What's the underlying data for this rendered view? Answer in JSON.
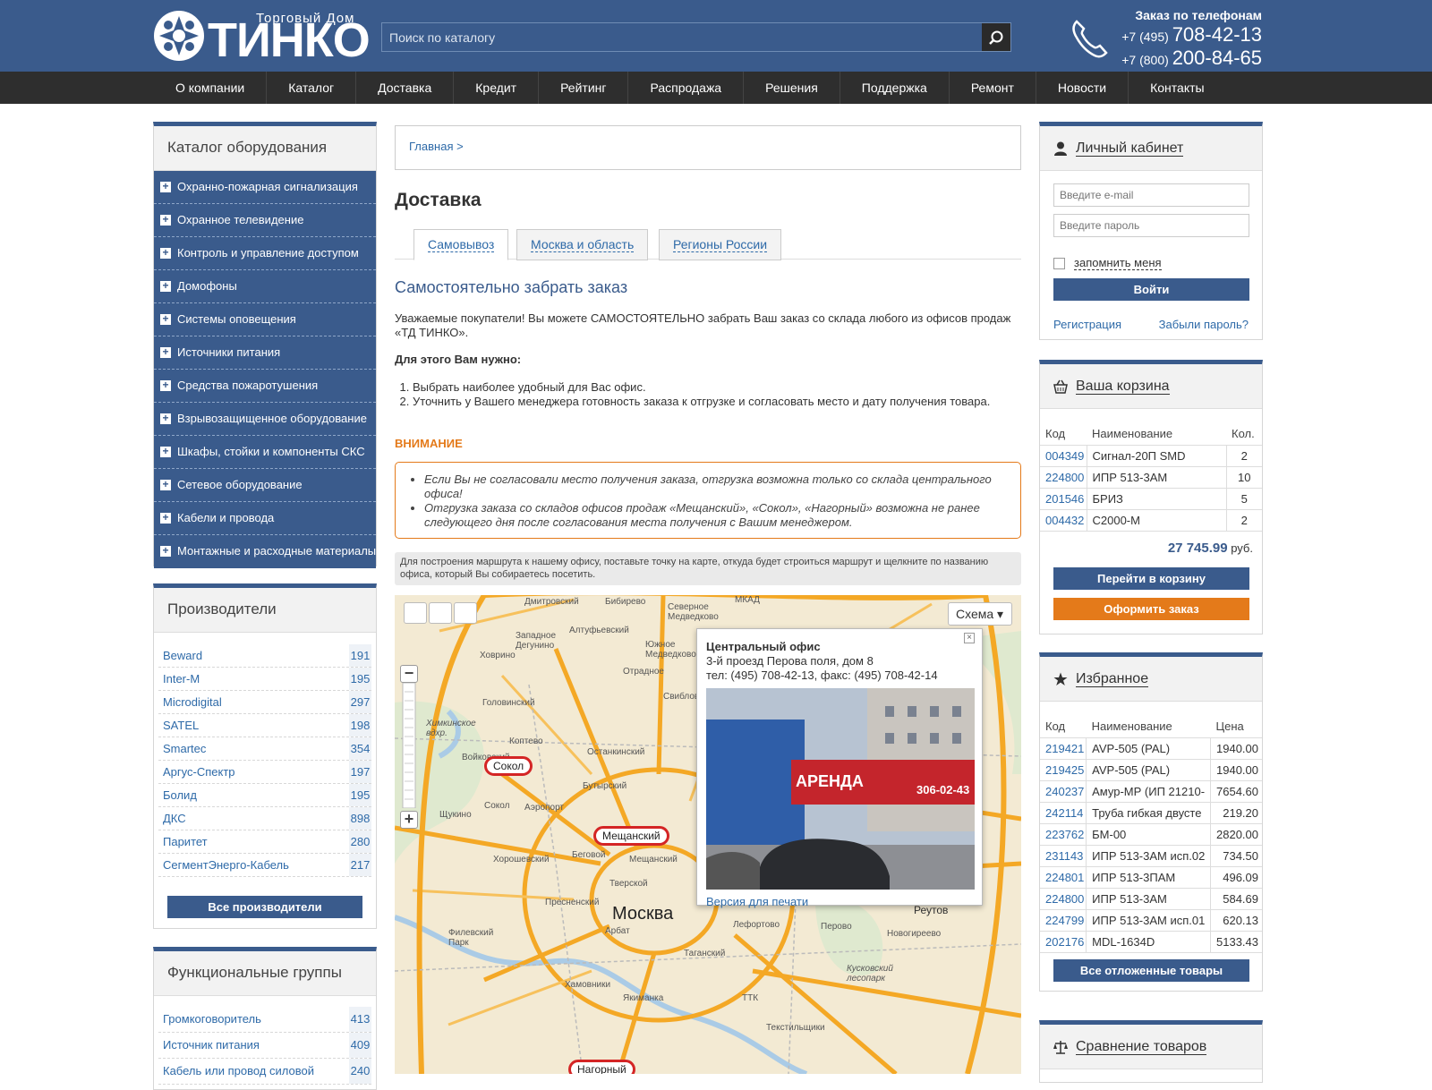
{
  "header": {
    "logo_sub": "Торговый Дом",
    "logo_text": "ТИНКО",
    "search_placeholder": "Поиск по каталогу",
    "phone_title": "Заказ по телефонам",
    "phone1_prefix": "+7 (495)",
    "phone1_number": "708-42-13",
    "phone2_prefix": "+7 (800)",
    "phone2_number": "200-84-65"
  },
  "nav": [
    "О компании",
    "Каталог",
    "Доставка",
    "Кредит",
    "Рейтинг",
    "Распродажа",
    "Решения",
    "Поддержка",
    "Ремонт",
    "Новости",
    "Контакты"
  ],
  "catalog": {
    "title": "Каталог оборудования",
    "items": [
      "Охранно-пожарная сигнализация",
      "Охранное телевидение",
      "Контроль и управление доступом",
      "Домофоны",
      "Системы оповещения",
      "Источники питания",
      "Средства пожаротушения",
      "Взрывозащищенное оборудование",
      "Шкафы, стойки и компоненты СКС",
      "Сетевое оборудование",
      "Кабели и провода",
      "Монтажные и расходные материалы"
    ]
  },
  "makers": {
    "title": "Производители",
    "items": [
      {
        "name": "Beward",
        "count": "191"
      },
      {
        "name": "Inter-M",
        "count": "195"
      },
      {
        "name": "Microdigital",
        "count": "297"
      },
      {
        "name": "SATEL",
        "count": "198"
      },
      {
        "name": "Smartec",
        "count": "354"
      },
      {
        "name": "Аргус-Спектр",
        "count": "197"
      },
      {
        "name": "Болид",
        "count": "195"
      },
      {
        "name": "ДКС",
        "count": "898"
      },
      {
        "name": "Паритет",
        "count": "280"
      },
      {
        "name": "СегментЭнерго-Кабель",
        "count": "217"
      }
    ],
    "all_label": "Все производители"
  },
  "groups": {
    "title": "Функциональные группы",
    "items": [
      {
        "name": "Громкоговоритель",
        "count": "413"
      },
      {
        "name": "Источник питания",
        "count": "409"
      },
      {
        "name": "Кабель или провод силовой",
        "count": "240"
      }
    ]
  },
  "content": {
    "breadcrumb": "Главная >",
    "title": "Доставка",
    "tabs": [
      "Самовывоз",
      "Москва и область",
      "Регионы России"
    ],
    "subtitle": "Самостоятельно забрать заказ",
    "intro": "Уважаемые покупатели! Вы можете САМОСТОЯТЕЛЬНО забрать Ваш заказ со склада любого из офисов продаж «ТД ТИНКО».",
    "need": "Для этого Вам нужно:",
    "steps": [
      "Выбрать наиболее удобный для Вас офис.",
      "Уточнить у Вашего менеджера готовность заказа к отгрузке и согласовать место и дату получения товара."
    ],
    "warn_title": "ВНИМАНИЕ",
    "warn_items": [
      "Если Вы не согласовали место получения заказа, отгрузка возможна только со склада центрального офиса!",
      "Отгрузка заказа со складов офисов продаж «Мещанский», «Сокол», «Нагорный» возможна не ранее следующего дня после согласования места получения с Вашим менеджером."
    ],
    "map_hint": "Для построения маршрута к нашему офису, поставьте точку на карте, откуда будет строиться маршрут и щелкните по названию офиса, который Вы собираетесь посетить."
  },
  "map": {
    "type_label": "Схема ▾",
    "city": "Москва",
    "pins": [
      "Сокол",
      "Мещанский",
      "Нагорный"
    ],
    "balloon": {
      "title": "Центральный офис",
      "address": "3-й проезд Перова поля, дом 8",
      "tel": "тел: (495) 708-42-13, факс: (495) 708-42-14",
      "photo_sign": "АРЕНДА",
      "photo_phone": "306-02-43",
      "print": "Версия для печати"
    },
    "labels": [
      "Дмитровский",
      "Бибирево",
      "Северное Медведково",
      "МКАД",
      "Западное Дегунино",
      "Алтуфьевский",
      "Южное Медведково",
      "Ховрино",
      "Отрадное",
      "Головинский",
      "Химкинское вдхр.",
      "Коптево",
      "Останкинский",
      "Войковский",
      "Свиблово",
      "Бутырский",
      "Щукино",
      "Сокол",
      "Аэропорт",
      "Хорошевский",
      "Беговой",
      "Тверской",
      "Мещанский",
      "Пресненский",
      "Филевский Парк",
      "Арбат",
      "Лефортово",
      "Перово",
      "Реутов",
      "Новогиреево",
      "Таганский",
      "Хамовники",
      "Якиманка",
      "Текстильщики",
      "Кусковский лесопарк",
      "ТТК"
    ]
  },
  "cabinet": {
    "title": "Личный кабинет",
    "email_placeholder": "Введите e-mail",
    "password_placeholder": "Введите пароль",
    "remember": "запомнить меня",
    "login": "Войти",
    "register": "Регистрация",
    "forgot": "Забыли пароль?"
  },
  "cart": {
    "title": "Ваша корзина",
    "headers": [
      "Код",
      "Наименование",
      "Кол."
    ],
    "rows": [
      {
        "code": "004349",
        "name": "Сигнал-20П SMD",
        "qty": "2"
      },
      {
        "code": "224800",
        "name": "ИПР 513-3АМ",
        "qty": "10"
      },
      {
        "code": "201546",
        "name": "БРИЗ",
        "qty": "5"
      },
      {
        "code": "004432",
        "name": "С2000-М",
        "qty": "2"
      }
    ],
    "total": "27 745.99",
    "currency": "руб.",
    "go_label": "Перейти в корзину",
    "order_label": "Оформить заказ"
  },
  "favorites": {
    "title": "Избранное",
    "headers": [
      "Код",
      "Наименование",
      "Цена"
    ],
    "rows": [
      {
        "code": "219421",
        "name": "AVP-505 (PAL)",
        "price": "1940.00"
      },
      {
        "code": "219425",
        "name": "AVP-505 (PAL)",
        "price": "1940.00"
      },
      {
        "code": "240237",
        "name": "Амур-МР (ИП 21210-",
        "price": "7654.60"
      },
      {
        "code": "242114",
        "name": "Труба гибкая двусте",
        "price": "219.20"
      },
      {
        "code": "223762",
        "name": "БМ-00",
        "price": "2820.00"
      },
      {
        "code": "231143",
        "name": "ИПР 513-3АМ исп.02",
        "price": "734.50"
      },
      {
        "code": "224801",
        "name": "ИПР 513-3ПАМ",
        "price": "496.09"
      },
      {
        "code": "224800",
        "name": "ИПР 513-3АМ",
        "price": "584.69"
      },
      {
        "code": "224799",
        "name": "ИПР 513-3АМ исп.01",
        "price": "620.13"
      },
      {
        "code": "202176",
        "name": "MDL-1634D",
        "price": "5133.43"
      }
    ],
    "all_label": "Все отложенные товары"
  },
  "compare": {
    "title": "Сравнение товаров"
  },
  "colors": {
    "brand": "#3a5b8c",
    "nav": "#2e2e2e",
    "accent": "#e47a1a",
    "link": "#2e6aa8"
  }
}
